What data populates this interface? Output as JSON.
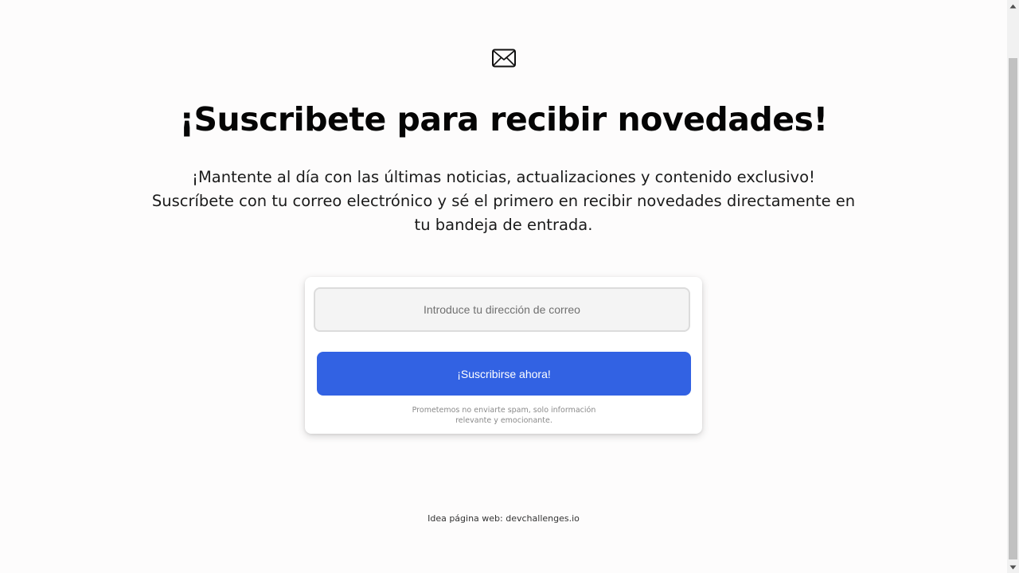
{
  "header": {
    "icon": "envelope-icon",
    "title": "¡Suscribete para recibir novedades!"
  },
  "intro": {
    "text": "¡Mantente al día con las últimas noticias, actualizaciones y contenido exclusivo! Suscríbete con tu correo electrónico y sé el primero en recibir novedades directamente en tu bandeja de entrada."
  },
  "form": {
    "email_placeholder": "Introduce tu dirección de correo",
    "email_value": "",
    "button_label": "¡Suscribirse ahora!",
    "disclaimer": "Prometemos no enviarte spam, solo información relevante y emocionante."
  },
  "footer": {
    "prefix": "Idea página web: ",
    "link_text": "devchallenges.io"
  },
  "colors": {
    "accent": "#3262e3",
    "background": "#fdfcfc"
  }
}
